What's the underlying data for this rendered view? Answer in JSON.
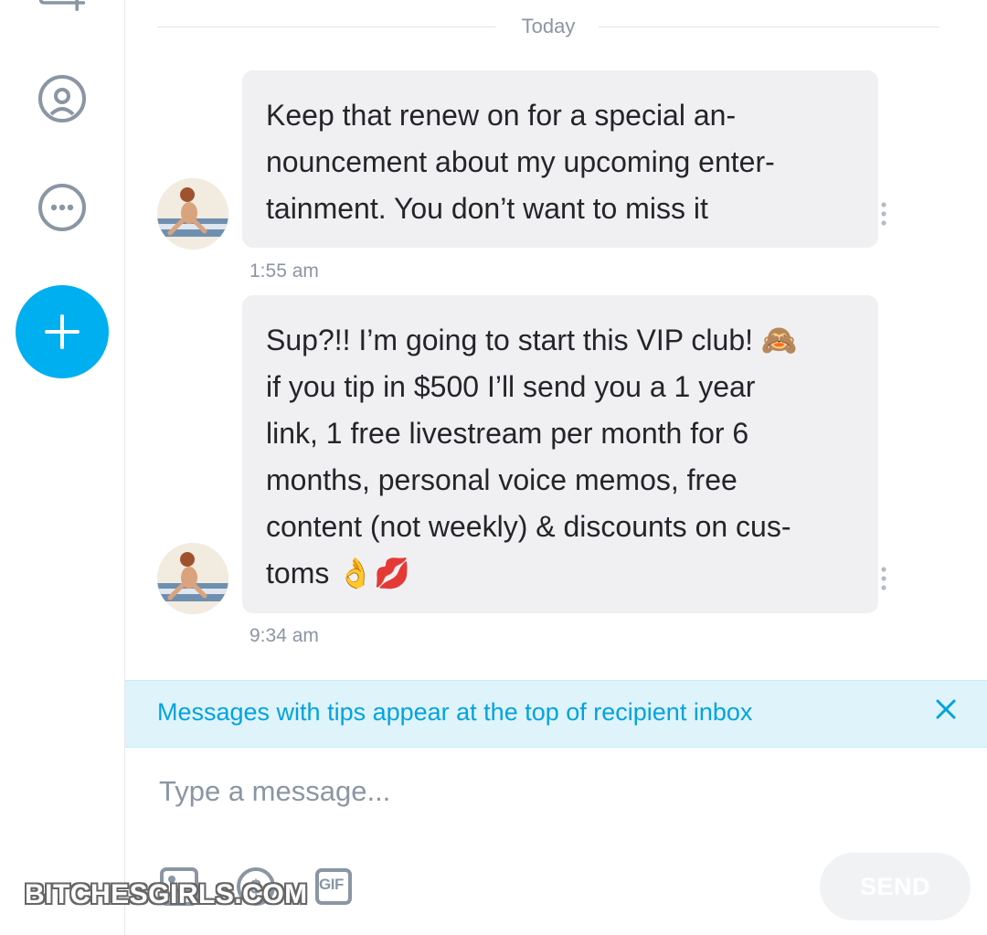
{
  "sidebar": {
    "icons": [
      "new-list-icon",
      "profile-icon",
      "more-icon",
      "add-icon"
    ]
  },
  "chat": {
    "date_divider": "Today",
    "messages": [
      {
        "text": "Keep that renew on for a special an-\nnouncement about my upcoming enter-\ntainment. You don’t want to miss it",
        "time": "1:55 am"
      },
      {
        "text": "Sup?!! I’m going to start this VIP club! 🙈\nif you tip in $500 I’ll send you a 1 year\nlink, 1 free livestream per month for 6\nmonths, personal voice memos, free\ncontent (not weekly) & discounts on cus-\ntoms 👌💋",
        "time": "9:34 am"
      }
    ]
  },
  "banner": {
    "text": "Messages with tips appear at the top of recipient inbox"
  },
  "composer": {
    "placeholder": "Type a message...",
    "tools": [
      "image-icon",
      "tip-icon",
      "gif-icon"
    ],
    "gif_label": "GIF",
    "send_label": "SEND"
  },
  "watermark": "BITCHESGIRLS.COM",
  "colors": {
    "accent": "#00aff0",
    "banner_bg": "#dff3fb",
    "bubble_bg": "#f0f0f3",
    "muted_text": "#8a96a3"
  }
}
